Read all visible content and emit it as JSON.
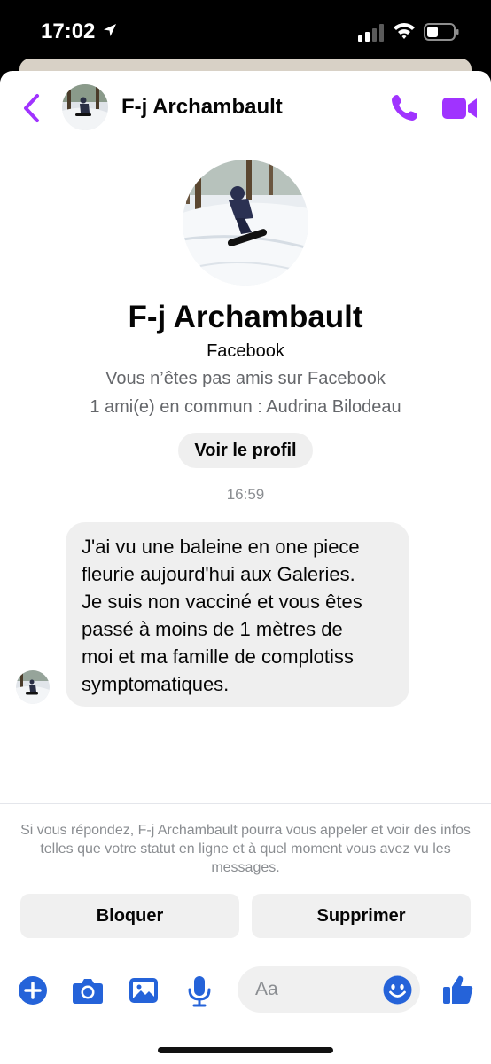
{
  "status_bar": {
    "time": "17:02"
  },
  "header": {
    "contact_name": "F-j Archambault"
  },
  "profile": {
    "name": "F-j Archambault",
    "source": "Facebook",
    "friend_status": "Vous n’êtes pas amis sur Facebook",
    "mutual_friends": "1 ami(e) en commun : Audrina Bilodeau",
    "view_profile_label": "Voir le profil"
  },
  "conversation": {
    "timestamp": "16:59",
    "message_lines": [
      "J'ai vu une baleine en one piece",
      "fleurie aujourd'hui aux Galeries.",
      "Je suis non vacciné et vous êtes",
      "passé à moins de 1 mètres de",
      "moi et ma famille de complotiss",
      "symptomatiques."
    ]
  },
  "notice": {
    "text": "Si vous répondez, F-j Archambault pourra vous appeler et voir des infos telles que votre statut en ligne et à quel moment vous avez vu les messages."
  },
  "actions": {
    "block_label": "Bloquer",
    "delete_label": "Supprimer"
  },
  "composer": {
    "placeholder": "Aa",
    "icons": [
      "plus-icon",
      "camera-icon",
      "gallery-icon",
      "microphone-icon",
      "emoji-icon",
      "thumbs-up-icon"
    ]
  },
  "colors": {
    "accent_purple": "#a033ff",
    "composer_blue": "#2563d9",
    "bubble_bg": "#efefef"
  }
}
